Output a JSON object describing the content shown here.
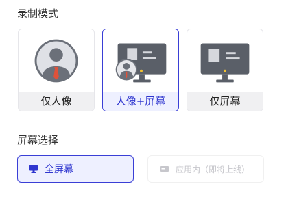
{
  "recording_mode": {
    "title": "录制模式",
    "options": [
      {
        "label": "仅人像",
        "icon": "person-avatar-icon",
        "selected": false
      },
      {
        "label": "人像+屏幕",
        "icon": "monitor-with-person-icon",
        "selected": true
      },
      {
        "label": "仅屏幕",
        "icon": "monitor-icon",
        "selected": false
      }
    ]
  },
  "screen_selection": {
    "title": "屏幕选择",
    "options": [
      {
        "label": "全屏幕",
        "icon": "monitor-icon",
        "selected": true,
        "disabled": false
      },
      {
        "label": "应用内（即将上线）",
        "icon": "app-window-icon",
        "selected": false,
        "disabled": true
      }
    ]
  },
  "colors": {
    "accent": "#3a3fd6",
    "selected_bg": "#eef0ff",
    "monitor_gray": "#5a5f68",
    "avatar_gray": "#6b7079",
    "tie_red": "#e0523a",
    "led_yellow": "#f2c230"
  }
}
